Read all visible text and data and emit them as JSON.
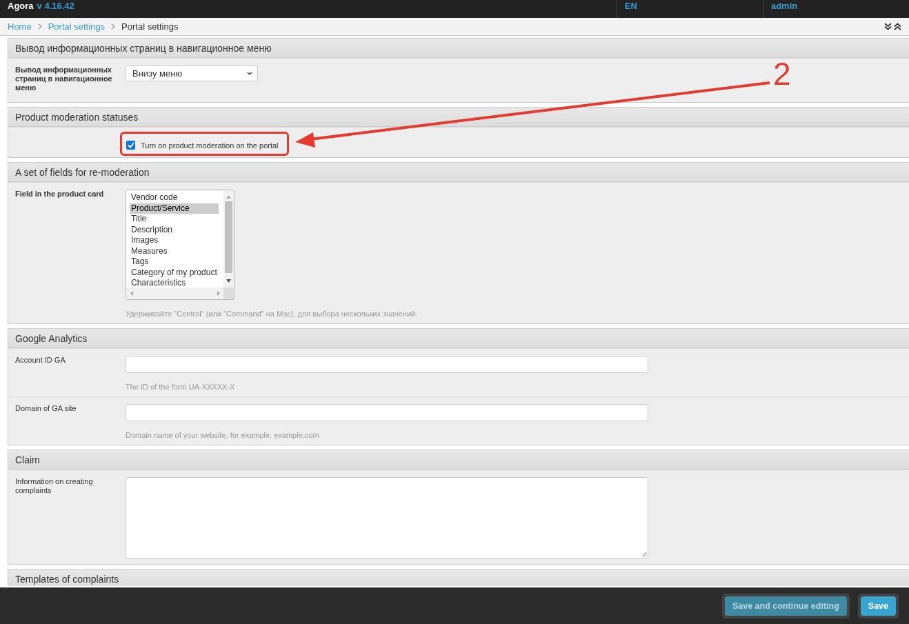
{
  "header": {
    "brand": "Agora",
    "version": "v 4.16.42",
    "language": "EN",
    "user": "admin"
  },
  "breadcrumbs": [
    {
      "label": "Home",
      "link": true
    },
    {
      "label": "Portal settings",
      "link": true
    },
    {
      "label": "Portal settings",
      "link": false
    }
  ],
  "sections": [
    {
      "title": "Вывод информационных страниц в навигационное меню",
      "fields": [
        {
          "kind": "select",
          "label": "Вывод информационных страниц в навигационное меню",
          "value": "Внизу меню"
        }
      ]
    },
    {
      "title": "Product moderation statuses",
      "fields": [
        {
          "kind": "checkbox",
          "label": "Turn on product moderation on the portal",
          "checked": true,
          "highlighted": true
        }
      ]
    },
    {
      "title": "A set of fields for re-moderation",
      "fields": [
        {
          "kind": "listbox",
          "label": "Field in the product card",
          "help": "Удерживайте \"Control\" (или \"Command\" на Mac), для выбора нескольких значений.",
          "options": [
            {
              "label": "Vendor code",
              "selected": false
            },
            {
              "label": "Product/Service",
              "selected": true
            },
            {
              "label": "Title",
              "selected": false
            },
            {
              "label": "Description",
              "selected": false
            },
            {
              "label": "Images",
              "selected": false
            },
            {
              "label": "Measures",
              "selected": false
            },
            {
              "label": "Tags",
              "selected": false
            },
            {
              "label": "Category of my product",
              "selected": false
            },
            {
              "label": "Characteristics",
              "selected": false
            }
          ]
        }
      ]
    },
    {
      "title": "Google Analytics",
      "fields": [
        {
          "kind": "text",
          "label": "Account ID GA",
          "help": "The ID of the form UA-XXXXX-X"
        },
        {
          "kind": "text",
          "label": "Domain of GA site",
          "help": "Domain name of your website, for example: example.com"
        }
      ]
    },
    {
      "title": "Claim",
      "fields": [
        {
          "kind": "textarea",
          "label": "Information on creating complaints"
        }
      ]
    },
    {
      "title": "Templates of complaints"
    }
  ],
  "annotation": {
    "label": "2"
  },
  "footer": {
    "buttons": [
      {
        "label": "Save and continue editing",
        "kind": "secondary"
      },
      {
        "label": "Save",
        "kind": "primary"
      }
    ]
  }
}
